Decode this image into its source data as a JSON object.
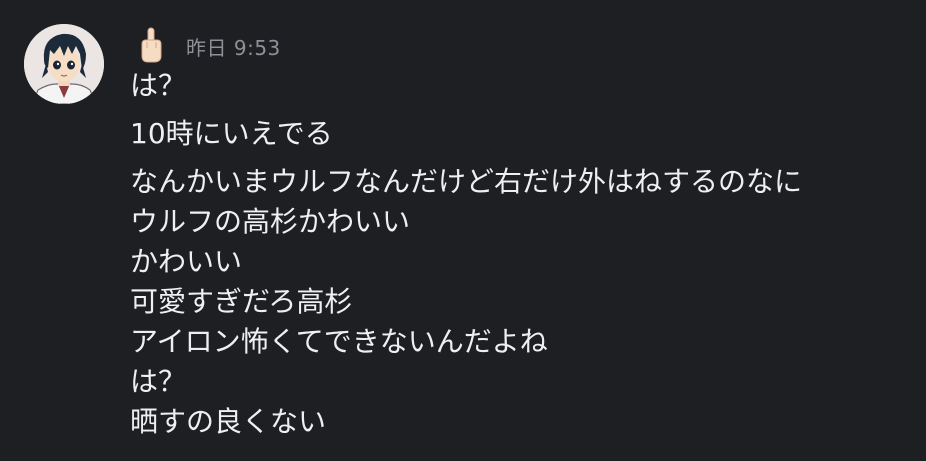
{
  "message": {
    "timestamp": "昨日 9:53",
    "lines": [
      "は？",
      "10時にいえでる",
      "なんかいまウルフなんだけど右だけ外はねするのなに",
      "ウルフの高杉かわいい",
      "かわいい",
      "可愛すぎだろ高杉",
      "アイロン怖くてできないんだよね",
      "は？",
      "晒すの良くない"
    ]
  },
  "author": {
    "avatar_icon": "anime-boy-avatar",
    "name_icon": "raised-middle-finger-emoji"
  }
}
